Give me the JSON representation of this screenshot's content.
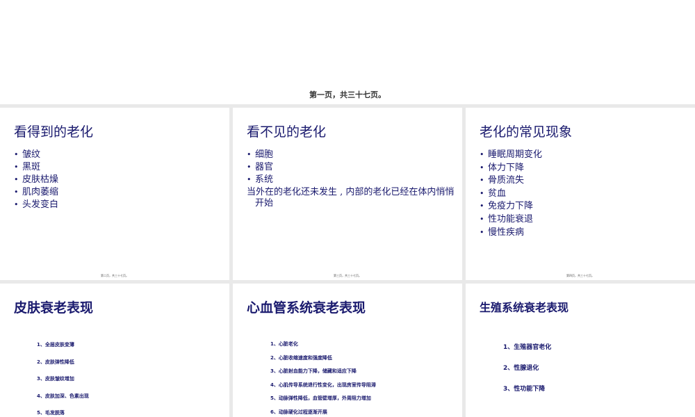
{
  "top_caption": "第一页，共三十七页。",
  "slide1": {
    "title": "看得到的老化",
    "items": [
      "皱纹",
      "黑斑",
      "皮肤枯燥",
      "肌肉萎缩",
      "头发变白"
    ],
    "footer": "第二页，共三十七页。"
  },
  "slide2": {
    "title": "看不见的老化",
    "items": [
      "细胞",
      "器官",
      "系统"
    ],
    "note": "当外在的老化还未发生 , 内部的老化已经在体内悄悄开始",
    "footer": "第三页，共三十七页。"
  },
  "slide3": {
    "title": "老化的常见现象",
    "items": [
      "睡眠周期变化",
      "体力下降",
      "骨质流失",
      "贫血",
      "免疫力下降",
      "性功能衰退",
      "慢性疾病"
    ],
    "footer": "第四页，共三十七页。"
  },
  "slide4": {
    "title": "皮肤衰老表现",
    "items": [
      "1、全层皮肤变薄",
      "2、皮肤弹性降低",
      "3、皮肤皱纹增加",
      "4、皮肤加深、色素出现",
      "5、毛发脱落"
    ]
  },
  "slide5": {
    "title": "心血管系统衰老表现",
    "items": [
      "1、心脏老化",
      "2、心脏收缩速度和强度降低",
      "3、心脏射血能力下降，储藏和适应下降",
      "4、心肌传导系统退行性变化，出现房室传导阻滞",
      "5、动脉弹性降低，血管壁增厚，外周阻力增加",
      "6、动脉硬化过程逐渐开展"
    ]
  },
  "slide6": {
    "title": "生殖系统衰老表现",
    "items": [
      "1、生殖器官老化",
      "2、性腺退化",
      "3、性功能下降"
    ]
  }
}
